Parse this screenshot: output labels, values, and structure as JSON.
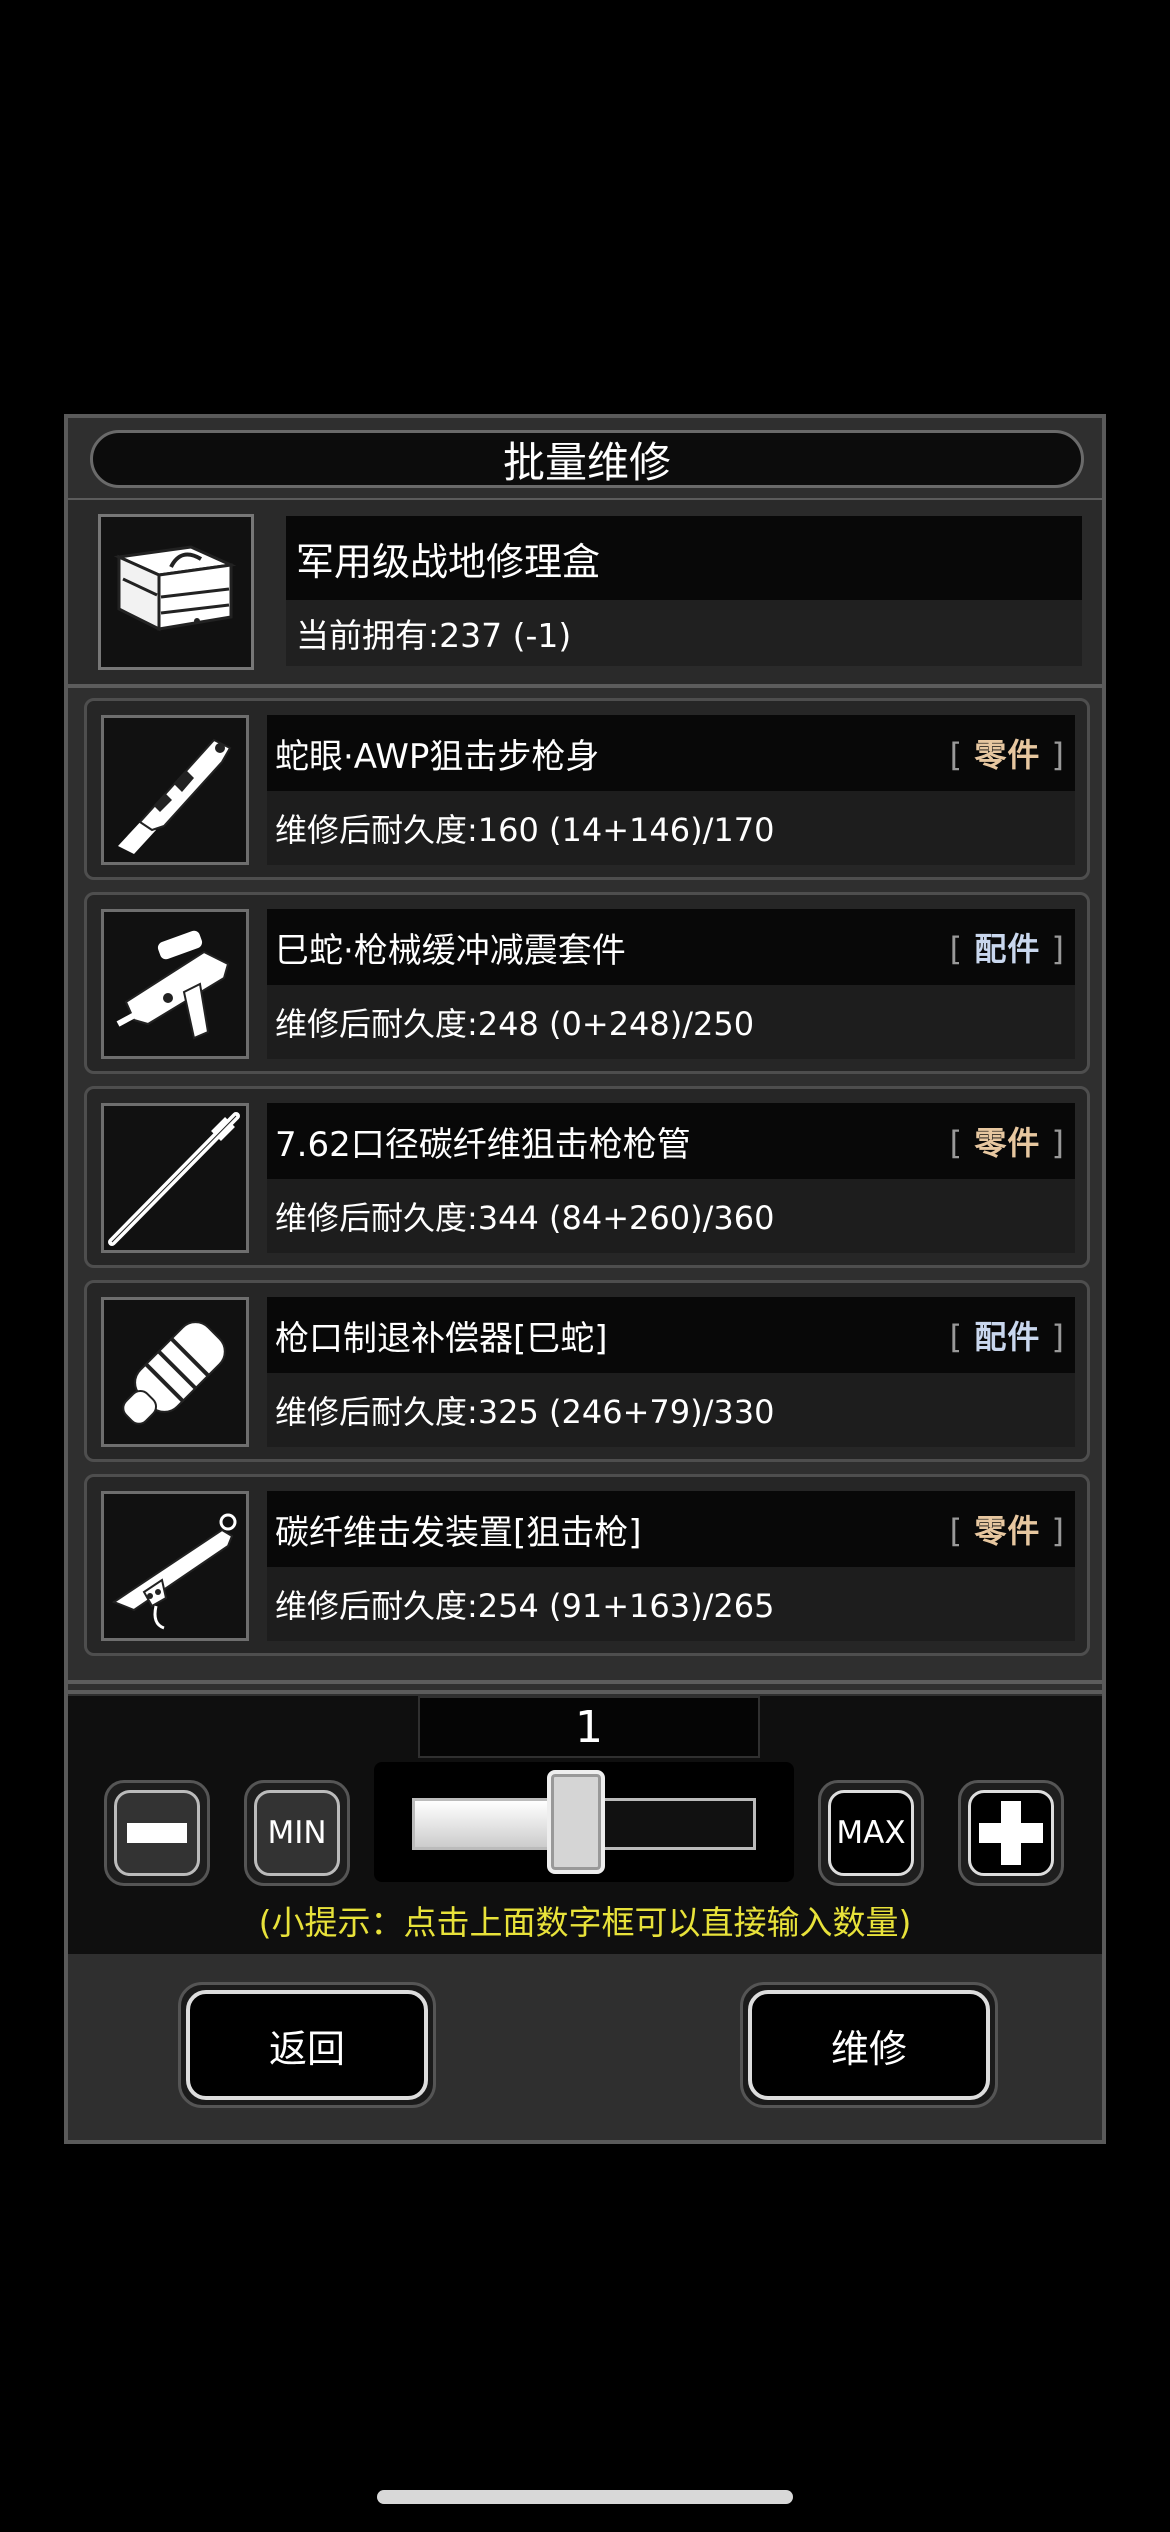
{
  "dialog": {
    "title": "批量维修",
    "kit": {
      "name": "军用级战地修理盒",
      "count": "当前拥有:237 (-1)",
      "icon": "toolbox-icon"
    },
    "items": [
      {
        "name": "蛇眼·AWP狙击步枪身",
        "durability": "维修后耐久度:160 (14+146)/170",
        "tag": "零件",
        "tag_type": "part",
        "icon": "rifle-stock-icon"
      },
      {
        "name": "巳蛇·枪械缓冲减震套件",
        "durability": "维修后耐久度:248 (0+248)/250",
        "tag": "配件",
        "tag_type": "accessory",
        "icon": "grip-kit-icon"
      },
      {
        "name": "7.62口径碳纤维狙击枪枪管",
        "durability": "维修后耐久度:344 (84+260)/360",
        "tag": "零件",
        "tag_type": "part",
        "icon": "barrel-icon"
      },
      {
        "name": "枪口制退补偿器[巳蛇]",
        "durability": "维修后耐久度:325 (246+79)/330",
        "tag": "配件",
        "tag_type": "accessory",
        "icon": "muzzle-brake-icon"
      },
      {
        "name": "碳纤维击发装置[狙击枪]",
        "durability": "维修后耐久度:254 (91+163)/265",
        "tag": "零件",
        "tag_type": "part",
        "icon": "trigger-assembly-icon"
      }
    ],
    "quantity": "1",
    "slider_fraction": 0.43,
    "min_label": "MIN",
    "max_label": "MAX",
    "tip": "(小提示：点击上面数字框可以直接输入数量)",
    "back_label": "返回",
    "repair_label": "维修"
  },
  "colors": {
    "tip": "#e8e23a",
    "part_tag": "#e7c7a0",
    "accessory_tag": "#c9d7ee"
  }
}
